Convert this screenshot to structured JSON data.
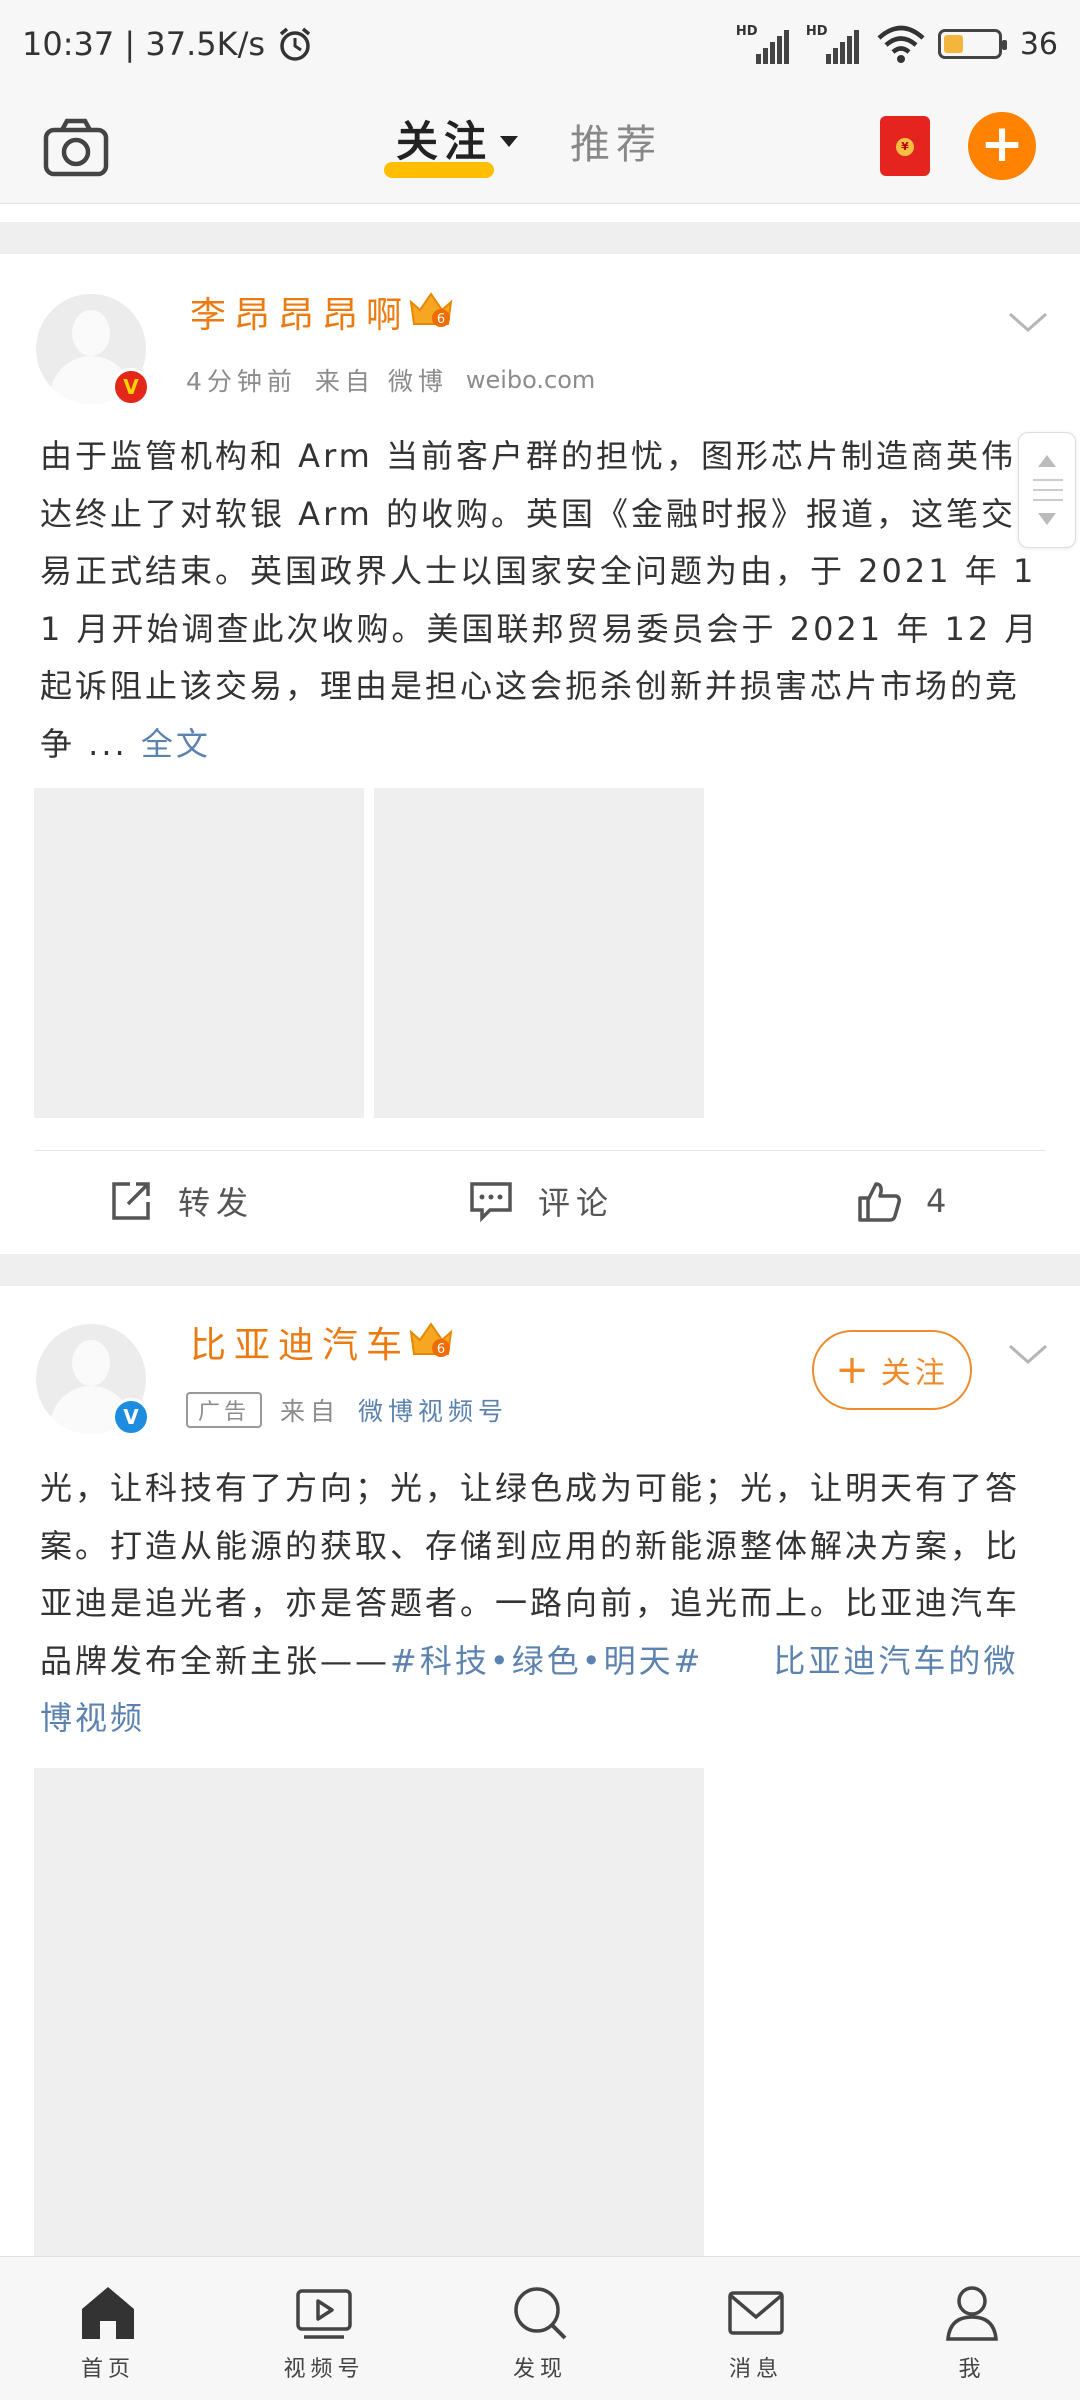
{
  "status_bar": {
    "time_speed": "10:37 | 37.5K/s",
    "battery": "36",
    "battery_level": 0.36
  },
  "header": {
    "tab_follow": "关注",
    "tab_recommend": "推荐"
  },
  "posts": [
    {
      "username": "李昂昂昂啊",
      "level_badge": "6",
      "badge": "V",
      "time": "4分钟前",
      "source_prefix": "来自 微博",
      "source": "weibo.com",
      "text": "由于监管机构和 Arm 当前客户群的担忧，图形芯片制造商英伟达终止了对软银 Arm 的收购。英国《金融时报》报道，这笔交易正式结束。英国政界人士以国家安全问题为由，于 2021 年 11 月开始调查此次收购。美国联邦贸易委员会于 2021 年 12 月起诉阻止该交易，理由是担心这会扼杀创新并损害芯片市场的竞争 ...",
      "more_link": "全文",
      "actions": {
        "repost": "转发",
        "comment": "评论",
        "like": "4"
      }
    },
    {
      "username": "比亚迪汽车",
      "level_badge": "6",
      "badge": "V",
      "ad_label": "广告",
      "source_prefix": "来自",
      "source": "微博视频号",
      "follow_button": "关注",
      "text": "光，让科技有了方向；光，让绿色成为可能；光，让明天有了答案。打造从能源的获取、存储到应用的新能源整体解决方案，比亚迪是追光者，亦是答题者。一路向前，追光而上。比亚迪汽车品牌发布全新主张——",
      "hashtag": "#科技•绿色•明天#",
      "video_link": "比亚迪汽车的微博视频"
    }
  ],
  "bottom_tabs": [
    {
      "label": "首页",
      "icon": "home-icon"
    },
    {
      "label": "视频号",
      "icon": "video-icon"
    },
    {
      "label": "发现",
      "icon": "discover-icon"
    },
    {
      "label": "消息",
      "icon": "message-icon"
    },
    {
      "label": "我",
      "icon": "profile-icon"
    }
  ],
  "colors": {
    "accent": "#ff8200",
    "username": "#eb7a10",
    "link": "#5c83b0",
    "underline": "#ffbe00"
  }
}
